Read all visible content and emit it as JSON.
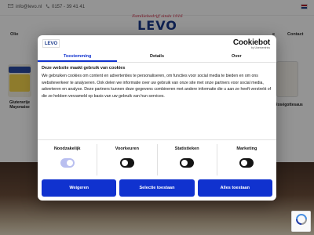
{
  "topbar": {
    "email": "info@levo.nl",
    "phone": "0157 - 39 41 41",
    "flag_colors": [
      "#ae1c28",
      "#ffffff",
      "#21468b"
    ]
  },
  "logo": {
    "tagline": "Familiebedrijf sinds 1916",
    "wordmark": "LEVO"
  },
  "nav": {
    "left_item": "Olie",
    "right_items": [
      "e",
      "Contact"
    ]
  },
  "products": {
    "left_label": "Glutenvrije Mayonaise",
    "right_label": "Roségottesaus"
  },
  "dialog": {
    "logo_text": "LEVO",
    "brand_name": "Cookiebot",
    "brand_by": "by Usercentrics",
    "tabs": [
      "Toestemming",
      "Details",
      "Over"
    ],
    "active_tab": 0,
    "heading": "Deze website maakt gebruik van cookies",
    "body": "We gebruiken cookies om content en advertenties te personaliseren, om functies voor social media te bieden en om ons websiteverkeer te analyseren. Ook delen we informatie over uw gebruik van onze site met onze partners voor social media, adverteren en analyse. Deze partners kunnen deze gegevens combineren met andere informatie die u aan ze heeft verstrekt of die ze hebben verzameld op basis van uw gebruik van hun services.",
    "toggles": [
      {
        "label": "Noodzakelijk",
        "state": "on-disabled"
      },
      {
        "label": "Voorkeuren",
        "state": "off"
      },
      {
        "label": "Statistieken",
        "state": "off"
      },
      {
        "label": "Marketing",
        "state": "off"
      }
    ],
    "buttons": {
      "deny": "Weigeren",
      "allow_selection": "Selectie toestaan",
      "allow_all": "Alles toestaan"
    }
  },
  "colors": {
    "accent": "#1032cf",
    "brand_blue": "#1a3a8c",
    "brand_red": "#c8102e"
  }
}
